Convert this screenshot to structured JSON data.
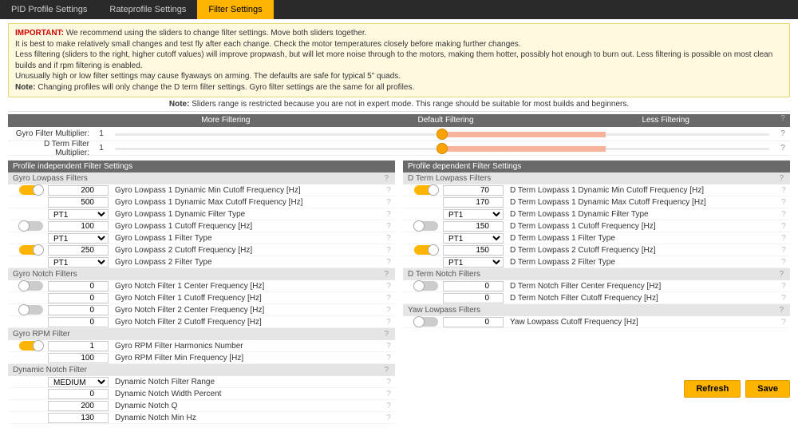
{
  "tabs": {
    "pid": "PID Profile Settings",
    "rate": "Rateprofile Settings",
    "filter": "Filter Settings"
  },
  "important": {
    "label": "IMPORTANT:",
    "line1": " We recommend using the sliders to change filter settings. Move both sliders together.",
    "line2": "It is best to make relatively small changes and test fly after each change. Check the motor temperatures closely before making further changes.",
    "line3": "Less filtering (sliders to the right, higher cutoff values) will improve propwash, but will let more noise through to the motors, making them hotter, possibly hot enough to burn out. Less filtering is possible on most clean builds and if rpm filtering is enabled.",
    "line4": "Unusually high or low filter settings may cause flyaways on arming. The defaults are safe for typical 5\" quads.",
    "note_label": "Note:",
    "note_text": " Changing profiles will only change the D term filter settings. Gyro filter settings are the same for all profiles."
  },
  "note_bar": {
    "label": "Note:",
    "text": " Sliders range is restricted because you are not in expert mode. This range should be suitable for most builds and beginners."
  },
  "slider_header": {
    "more": "More Filtering",
    "default": "Default Filtering",
    "less": "Less Filtering"
  },
  "sliders": {
    "gyro": {
      "label": "Gyro Filter Multiplier:",
      "value": "1"
    },
    "dterm": {
      "label": "D Term Filter Multiplier:",
      "value": "1"
    }
  },
  "left": {
    "title": "Profile independent Filter Settings",
    "gyro_lowpass": {
      "title": "Gyro Lowpass Filters",
      "rows": [
        {
          "val": "200",
          "label": "Gyro Lowpass 1 Dynamic Min Cutoff Frequency [Hz]"
        },
        {
          "val": "500",
          "label": "Gyro Lowpass 1 Dynamic Max Cutoff Frequency [Hz]"
        },
        {
          "val": "PT1",
          "label": "Gyro Lowpass 1 Dynamic Filter Type",
          "select": true
        },
        {
          "val": "100",
          "label": "Gyro Lowpass 1 Cutoff Frequency [Hz]"
        },
        {
          "val": "PT1",
          "label": "Gyro Lowpass 1 Filter Type",
          "select": true
        },
        {
          "val": "250",
          "label": "Gyro Lowpass 2 Cutoff Frequency [Hz]"
        },
        {
          "val": "PT1",
          "label": "Gyro Lowpass 2 Filter Type",
          "select": true
        }
      ]
    },
    "gyro_notch": {
      "title": "Gyro Notch Filters",
      "rows": [
        {
          "val": "0",
          "label": "Gyro Notch Filter 1 Center Frequency [Hz]"
        },
        {
          "val": "0",
          "label": "Gyro Notch Filter 1 Cutoff Frequency [Hz]"
        },
        {
          "val": "0",
          "label": "Gyro Notch Filter 2 Center Frequency [Hz]"
        },
        {
          "val": "0",
          "label": "Gyro Notch Filter 2 Cutoff Frequency [Hz]"
        }
      ]
    },
    "gyro_rpm": {
      "title": "Gyro RPM Filter",
      "rows": [
        {
          "val": "1",
          "label": "Gyro RPM Filter Harmonics Number"
        },
        {
          "val": "100",
          "label": "Gyro RPM Filter Min Frequency [Hz]"
        }
      ]
    },
    "dyn_notch": {
      "title": "Dynamic Notch Filter",
      "rows": [
        {
          "val": "MEDIUM",
          "label": "Dynamic Notch Filter Range",
          "select": true
        },
        {
          "val": "0",
          "label": "Dynamic Notch Width Percent"
        },
        {
          "val": "200",
          "label": "Dynamic Notch Q"
        },
        {
          "val": "130",
          "label": "Dynamic Notch Min Hz"
        }
      ]
    }
  },
  "right": {
    "title": "Profile dependent Filter Settings",
    "dterm_lowpass": {
      "title": "D Term Lowpass Filters",
      "rows": [
        {
          "val": "70",
          "label": "D Term Lowpass 1 Dynamic Min Cutoff Frequency [Hz]"
        },
        {
          "val": "170",
          "label": "D Term Lowpass 1 Dynamic Max Cutoff Frequency [Hz]"
        },
        {
          "val": "PT1",
          "label": "D Term Lowpass 1 Dynamic Filter Type",
          "select": true
        },
        {
          "val": "150",
          "label": "D Term Lowpass 1 Cutoff Frequency [Hz]"
        },
        {
          "val": "PT1",
          "label": "D Term Lowpass 1 Filter Type",
          "select": true
        },
        {
          "val": "150",
          "label": "D Term Lowpass 2 Cutoff Frequency [Hz]"
        },
        {
          "val": "PT1",
          "label": "D Term Lowpass 2 Filter Type",
          "select": true
        }
      ]
    },
    "dterm_notch": {
      "title": "D Term Notch Filters",
      "rows": [
        {
          "val": "0",
          "label": "D Term Notch Filter Center Frequency [Hz]"
        },
        {
          "val": "0",
          "label": "D Term Notch Filter Cutoff Frequency [Hz]"
        }
      ]
    },
    "yaw_lowpass": {
      "title": "Yaw Lowpass Filters",
      "rows": [
        {
          "val": "0",
          "label": "Yaw Lowpass Cutoff Frequency [Hz]"
        }
      ]
    }
  },
  "footer": {
    "refresh": "Refresh",
    "save": "Save"
  }
}
